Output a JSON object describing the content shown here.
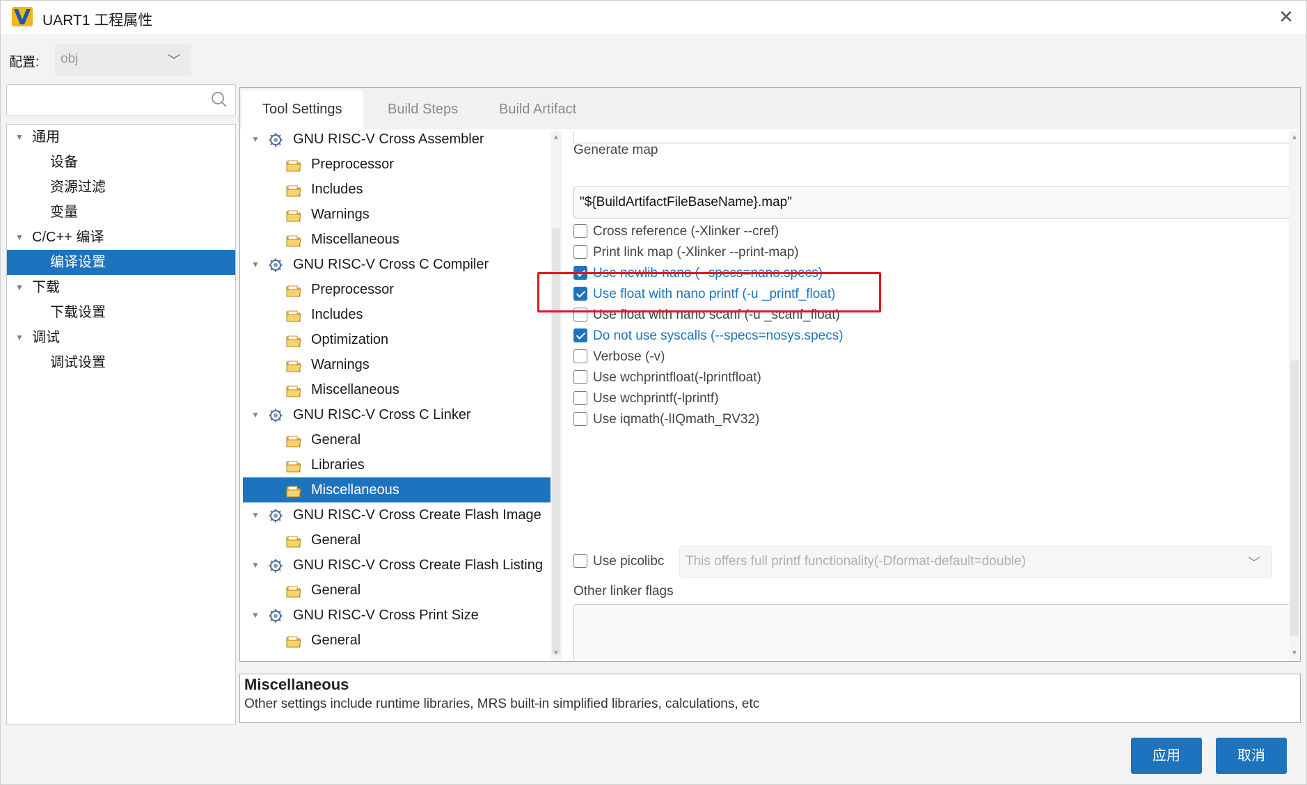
{
  "window": {
    "title": "UART1 工程属性"
  },
  "config": {
    "label": "配置:",
    "value": "obj"
  },
  "left_tree": [
    {
      "label": "通用",
      "level": 0,
      "expanded": true
    },
    {
      "label": "设备",
      "level": 1
    },
    {
      "label": "资源过滤",
      "level": 1
    },
    {
      "label": "变量",
      "level": 1
    },
    {
      "label": "C/C++ 编译",
      "level": 0,
      "expanded": true
    },
    {
      "label": "编译设置",
      "level": 1,
      "selected": true
    },
    {
      "label": "下载",
      "level": 0,
      "expanded": true
    },
    {
      "label": "下载设置",
      "level": 1
    },
    {
      "label": "调试",
      "level": 0,
      "expanded": true
    },
    {
      "label": "调试设置",
      "level": 1
    }
  ],
  "tabs": [
    {
      "label": "Tool Settings",
      "active": true
    },
    {
      "label": "Build Steps"
    },
    {
      "label": "Build Artifact"
    }
  ],
  "tool_tree": [
    {
      "label": "GNU RISC-V Cross Assembler",
      "type": "tool"
    },
    {
      "label": "Preprocessor",
      "type": "folder"
    },
    {
      "label": "Includes",
      "type": "folder"
    },
    {
      "label": "Warnings",
      "type": "folder"
    },
    {
      "label": "Miscellaneous",
      "type": "folder"
    },
    {
      "label": "GNU RISC-V Cross C Compiler",
      "type": "tool"
    },
    {
      "label": "Preprocessor",
      "type": "folder"
    },
    {
      "label": "Includes",
      "type": "folder"
    },
    {
      "label": "Optimization",
      "type": "folder"
    },
    {
      "label": "Warnings",
      "type": "folder"
    },
    {
      "label": "Miscellaneous",
      "type": "folder"
    },
    {
      "label": "GNU RISC-V Cross C Linker",
      "type": "tool"
    },
    {
      "label": "General",
      "type": "folder"
    },
    {
      "label": "Libraries",
      "type": "folder"
    },
    {
      "label": "Miscellaneous",
      "type": "folder",
      "selected": true
    },
    {
      "label": "GNU RISC-V Cross Create Flash Image",
      "type": "tool"
    },
    {
      "label": "General",
      "type": "folder"
    },
    {
      "label": "GNU RISC-V Cross Create Flash Listing",
      "type": "tool"
    },
    {
      "label": "General",
      "type": "folder"
    },
    {
      "label": "GNU RISC-V Cross Print Size",
      "type": "tool"
    },
    {
      "label": "General",
      "type": "folder"
    }
  ],
  "settings": {
    "generate_map_label": "Generate map",
    "generate_map_value": "\"${BuildArtifactFileBaseName}.map\"",
    "checkboxes": [
      {
        "label": "Cross reference (-Xlinker --cref)",
        "checked": false
      },
      {
        "label": "Print link map (-Xlinker --print-map)",
        "checked": false
      },
      {
        "label": "Use newlib-nano (--specs=nano.specs)",
        "checked": true
      },
      {
        "label": "Use float with nano printf (-u _printf_float)",
        "checked": true
      },
      {
        "label": "Use float with nano scanf (-u _scanf_float)",
        "checked": false
      },
      {
        "label": "Do not use syscalls (--specs=nosys.specs)",
        "checked": true
      },
      {
        "label": "Verbose (-v)",
        "checked": false
      },
      {
        "label": "Use wchprintfloat(-lprintfloat)",
        "checked": false
      },
      {
        "label": "Use wchprintf(-lprintf)",
        "checked": false
      },
      {
        "label": "Use iqmath(-lIQmath_RV32)",
        "checked": false
      }
    ],
    "picolibc_label": "Use picolibc",
    "picolibc_checked": false,
    "picolibc_option": "This offers full printf functionality(-Dformat-default=double)",
    "other_flags_label": "Other linker flags",
    "other_flags_value": ""
  },
  "description": {
    "title": "Miscellaneous",
    "text": "Other settings include runtime libraries, MRS built-in simplified libraries, calculations, etc"
  },
  "buttons": {
    "apply": "应用",
    "cancel": "取消"
  },
  "colors": {
    "accent": "#1e73be",
    "highlight": "#e01818"
  }
}
